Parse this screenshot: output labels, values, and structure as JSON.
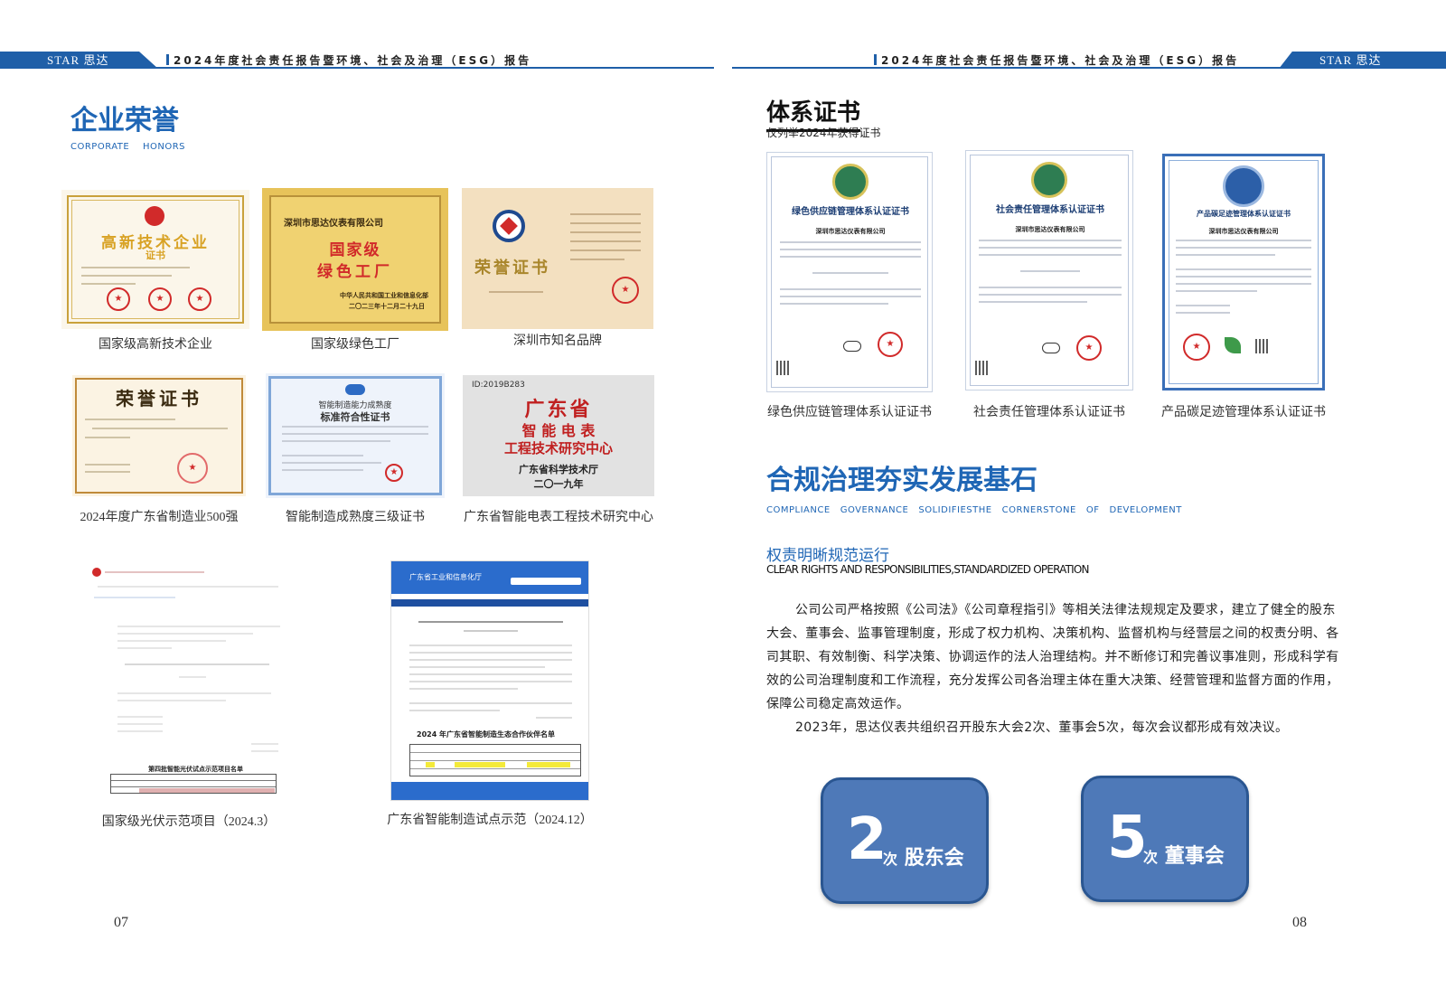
{
  "header": {
    "brand": "STAR   思达",
    "title": "2024年度社会责任报告暨环境、社会及治理（ESG）报告"
  },
  "left": {
    "section_title": "企业荣誉",
    "section_en": "CORPORATE    HONORS",
    "certs": [
      {
        "caption": "国家级高新技术企业",
        "heading": "高新技术企业",
        "sub": "证书"
      },
      {
        "caption": "国家级绿色工厂",
        "issuer_line": "深圳市思达仪表有限公司",
        "heading1": "国家级",
        "heading2": "绿色工厂",
        "footer1": "中华人民共和国工业和信息化部",
        "footer2": "二〇二三年十二月二十九日"
      },
      {
        "caption": "深圳市知名品牌",
        "heading": "荣誉证书"
      },
      {
        "caption": "2024年度广东省制造业500强",
        "heading": "荣誉证书"
      },
      {
        "caption": "智能制造成熟度三级证书",
        "heading1": "智能制造能力成熟度",
        "heading2": "标准符合性证书"
      },
      {
        "caption": "广东省智能电表工程技术研究中心",
        "id_line": "ID:2019B283",
        "heading1": "广东省",
        "heading2": "智 能 电 表",
        "heading3": "工程技术研究中心",
        "issuer": "广东省科学技术厅",
        "year": "二〇一九年"
      },
      {
        "caption": "国家级光伏示范项目（2024.3）",
        "table_title": "第四批智能光伏试点示范项目名单"
      },
      {
        "caption": "广东省智能制造试点示范（2024.12）",
        "site_title": "广东省工业和信息化厅",
        "list_title": "2024 年广东省智能制造生态合作伙伴名单"
      }
    ],
    "page_number": "07"
  },
  "right": {
    "cert_section_title": "体系证书",
    "cert_section_sub": "仅列举2024年获得证书",
    "sys_certs": [
      {
        "caption": "绿色供应链管理体系认证证书",
        "heading": "绿色供应链管理体系认证证书",
        "company": "深圳市思达仪表有限公司"
      },
      {
        "caption": "社会责任管理体系认证证书",
        "heading": "社会责任管理体系认证证书",
        "company": "深圳市思达仪表有限公司"
      },
      {
        "caption": "产品碳足迹管理体系认证证书",
        "heading": "产品碳足迹管理体系认证证书",
        "company": "深圳市思达仪表有限公司"
      }
    ],
    "gov_title": "合规治理夯实发展基石",
    "gov_en": "COMPLIANCE   GOVERNANCE   SOLIDIFIESTHE   CORNERSTONE   OF   DEVELOPMENT",
    "sub_title": "权责明晰规范运行",
    "sub_en": "CLEAR RIGHTS AND RESPONSIBILITIES,STANDARDIZED OPERATION",
    "paragraph1": "公司公司严格按照《公司法》《公司章程指引》等相关法律法规规定及要求，建立了健全的股东大会、董事会、监事管理制度，形成了权力机构、决策机构、监督机构与经营层之间的权责分明、各司其职、有效制衡、科学决策、协调运作的法人治理结构。并不断修订和完善议事准则，形成科学有效的公司治理制度和工作流程，充分发挥公司各治理主体在重大决策、经营管理和监督方面的作用，保障公司稳定高效运作。",
    "paragraph2": "2023年，思达仪表共组织召开股东大会2次、董事会5次，每次会议都形成有效决议。",
    "stats": [
      {
        "value": "2",
        "unit": "次",
        "label": "股东会"
      },
      {
        "value": "5",
        "unit": "次",
        "label": "董事会"
      }
    ],
    "page_number": "08"
  },
  "colors": {
    "brand_blue": "#1f5fa8",
    "title_blue": "#1f66b5",
    "stat_blue": "#4e79b8",
    "seal_red": "#d12a2a",
    "gold": "#c9a13b"
  }
}
